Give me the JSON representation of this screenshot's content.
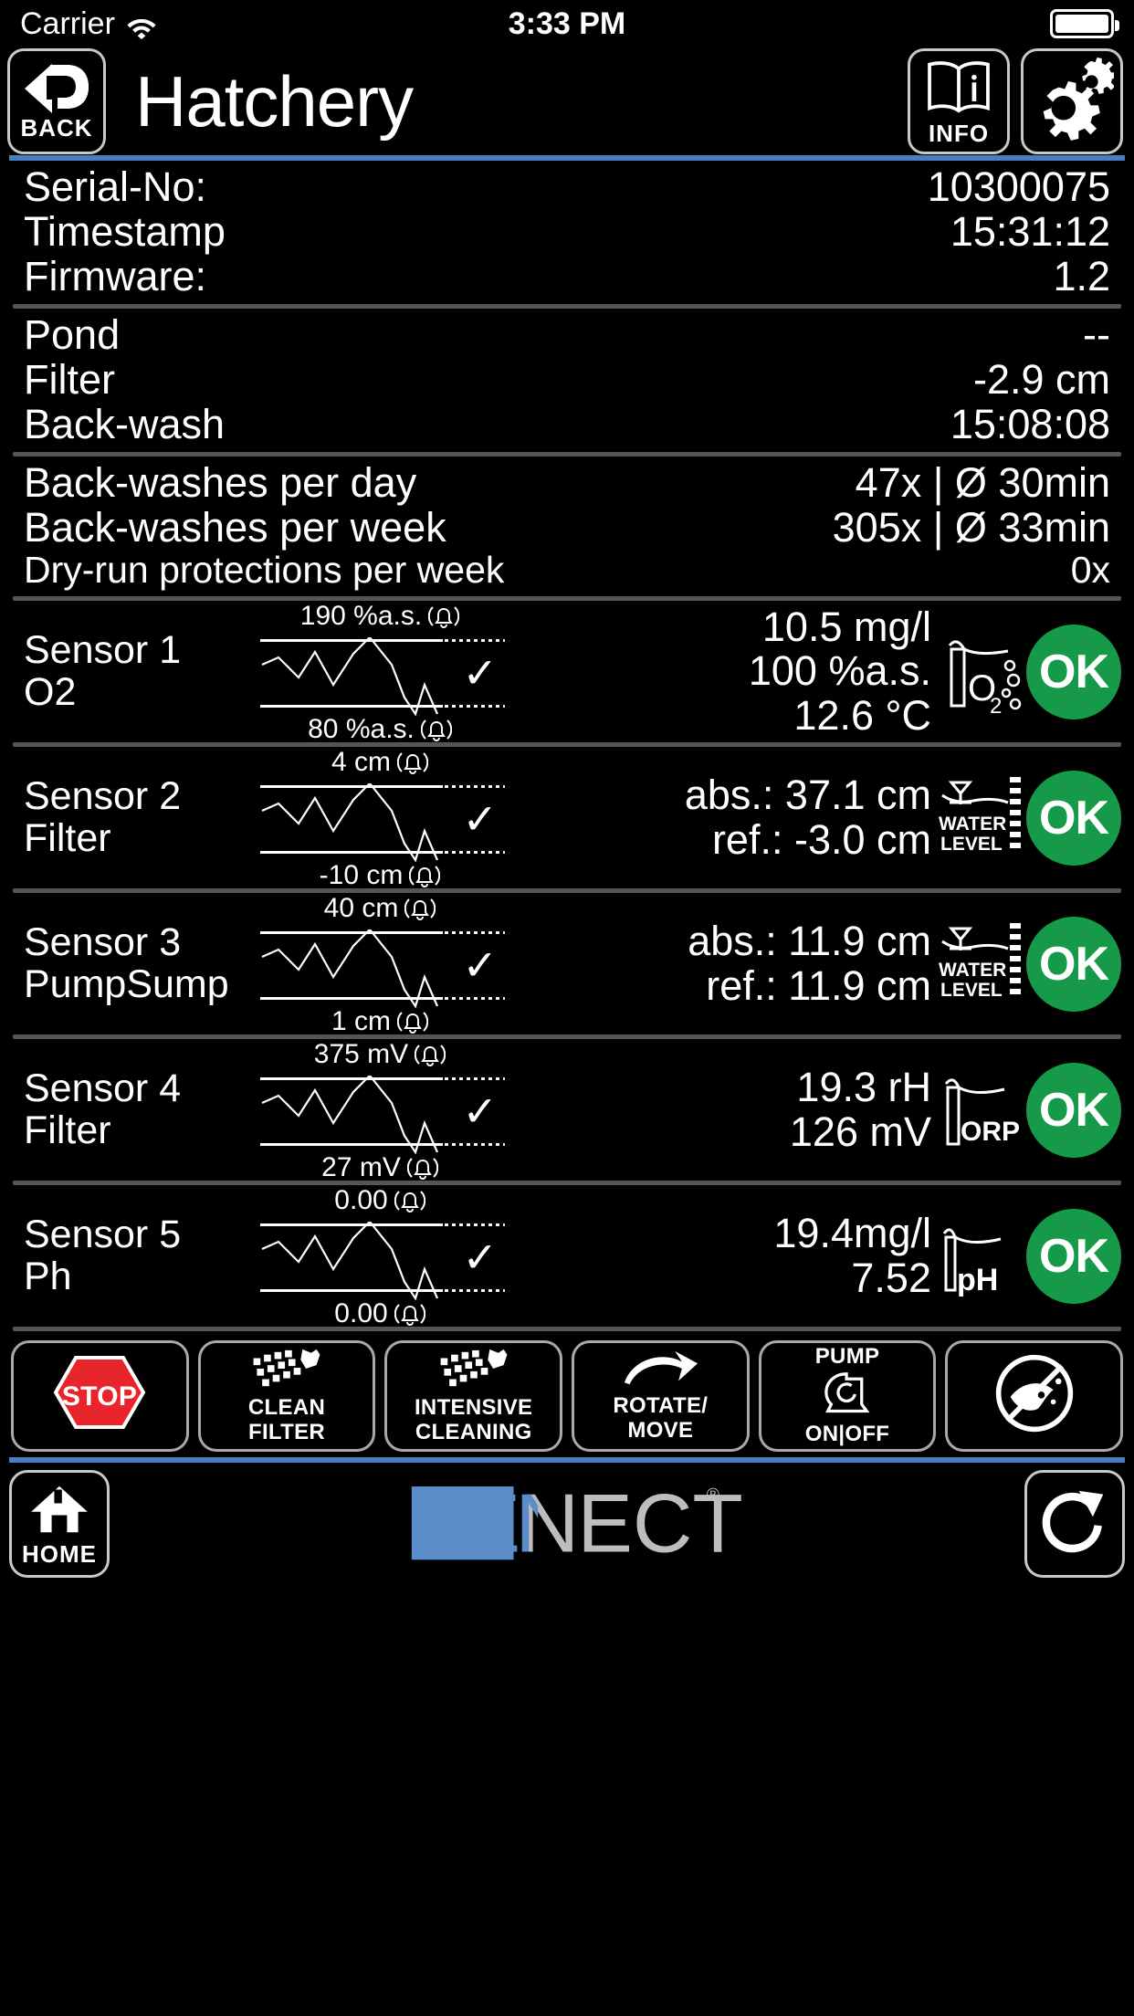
{
  "statusbar": {
    "carrier": "Carrier",
    "time": "3:33 PM",
    "wifi_icon": "wifi-icon",
    "battery_icon": "battery-icon"
  },
  "header": {
    "title": "Hatchery",
    "back_label": "BACK",
    "info_label": "INFO",
    "settings_icon": "gear-icon",
    "back_icon": "back-arrow-icon",
    "info_icon": "book-info-icon"
  },
  "device_info": [
    {
      "label": "Serial-No:",
      "value": "10300075"
    },
    {
      "label": "Timestamp",
      "value": "15:31:12"
    },
    {
      "label": "Firmware:",
      "value": "1.2"
    }
  ],
  "levels": [
    {
      "label": "Pond",
      "value": "--"
    },
    {
      "label": "Filter",
      "value": "-2.9 cm"
    },
    {
      "label": "Back-wash",
      "value": "15:08:08"
    }
  ],
  "statistics": [
    {
      "label": "Back-washes per day",
      "value": "47x | Ø 30min"
    },
    {
      "label": "Back-washes per week",
      "value": "305x | Ø 33min"
    },
    {
      "label": "Dry-run protections per week",
      "value": "0x"
    }
  ],
  "sensors": [
    {
      "name": "Sensor 1",
      "type": "O2",
      "limit_high": "190 %a.s.",
      "limit_low": "80 %a.s.",
      "check": "✓",
      "readings": [
        "10.5 mg/l",
        "100 %a.s.",
        "12.6 °C"
      ],
      "icon": "o2-probe-icon",
      "icon_label": "O2",
      "status": "OK",
      "status_color": "#17994a"
    },
    {
      "name": "Sensor 2",
      "type": "Filter",
      "limit_high": "4 cm",
      "limit_low": "-10 cm",
      "check": "✓",
      "readings": [
        "abs.: 37.1 cm",
        "ref.: -3.0 cm"
      ],
      "icon": "water-level-icon",
      "icon_label": "WATER LEVEL",
      "status": "OK",
      "status_color": "#17994a"
    },
    {
      "name": "Sensor 3",
      "type": "PumpSump",
      "limit_high": "40 cm",
      "limit_low": "1 cm",
      "check": "✓",
      "readings": [
        "abs.: 11.9 cm",
        "ref.: 11.9 cm"
      ],
      "icon": "water-level-icon",
      "icon_label": "WATER LEVEL",
      "status": "OK",
      "status_color": "#17994a"
    },
    {
      "name": "Sensor 4",
      "type": "Filter",
      "limit_high": "375 mV",
      "limit_low": "27 mV",
      "check": "✓",
      "readings": [
        "19.3 rH",
        "126 mV"
      ],
      "icon": "orp-probe-icon",
      "icon_label": "ORP",
      "status": "OK",
      "status_color": "#17994a"
    },
    {
      "name": "Sensor 5",
      "type": "Ph",
      "limit_high": "0.00",
      "limit_low": "0.00",
      "check": "✓",
      "readings": [
        "19.4mg/l",
        "7.52"
      ],
      "icon": "ph-probe-icon",
      "icon_label": "pH",
      "status": "OK",
      "status_color": "#17994a"
    }
  ],
  "toolbar": [
    {
      "icon": "stop-sign-icon",
      "line1": "STOP",
      "line2": ""
    },
    {
      "icon": "spray-clean-icon",
      "line1": "CLEAN",
      "line2": "FILTER"
    },
    {
      "icon": "spray-clean-icon",
      "line1": "INTENSIVE",
      "line2": "CLEANING"
    },
    {
      "icon": "rotate-arrow-icon",
      "line1": "ROTATE/",
      "line2": "MOVE"
    },
    {
      "icon": "pump-icon",
      "line1": "PUMP",
      "line2": "ON|OFF"
    },
    {
      "icon": "no-feeding-icon",
      "line1": "",
      "line2": ""
    }
  ],
  "footer": {
    "home_label": "HOME",
    "home_icon": "home-icon",
    "refresh_icon": "refresh-icon",
    "brand": "SENECT",
    "brand_mark": "®",
    "brand_blue": "#5b8dc8",
    "brand_grey": "#bdbdbd"
  }
}
